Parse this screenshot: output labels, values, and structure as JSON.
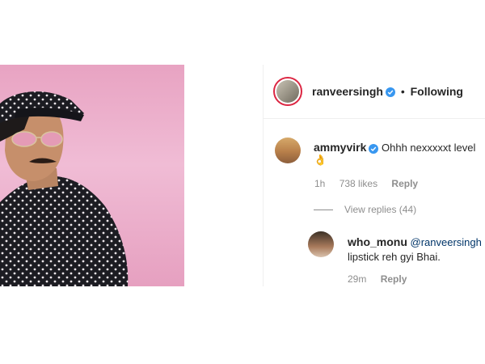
{
  "post": {
    "author": "ranveersingh",
    "separator": "•",
    "follow_status": "Following"
  },
  "comments": [
    {
      "username": "ammyvirk",
      "verified": true,
      "text": "Ohhh nexxxxxt level",
      "emoji": "👌",
      "time": "1h",
      "likes": "738 likes",
      "reply_label": "Reply",
      "view_replies": "View replies (44)"
    },
    {
      "username": "who_monu",
      "mention": "@ranveersingh",
      "text": "lipstick reh gyi Bhai.",
      "time": "29m",
      "reply_label": "Reply"
    }
  ],
  "colors": {
    "verified_badge": "#3897f0",
    "mention": "#003569",
    "muted": "#8e8e8e",
    "photo_background": "#eeb2cf"
  }
}
